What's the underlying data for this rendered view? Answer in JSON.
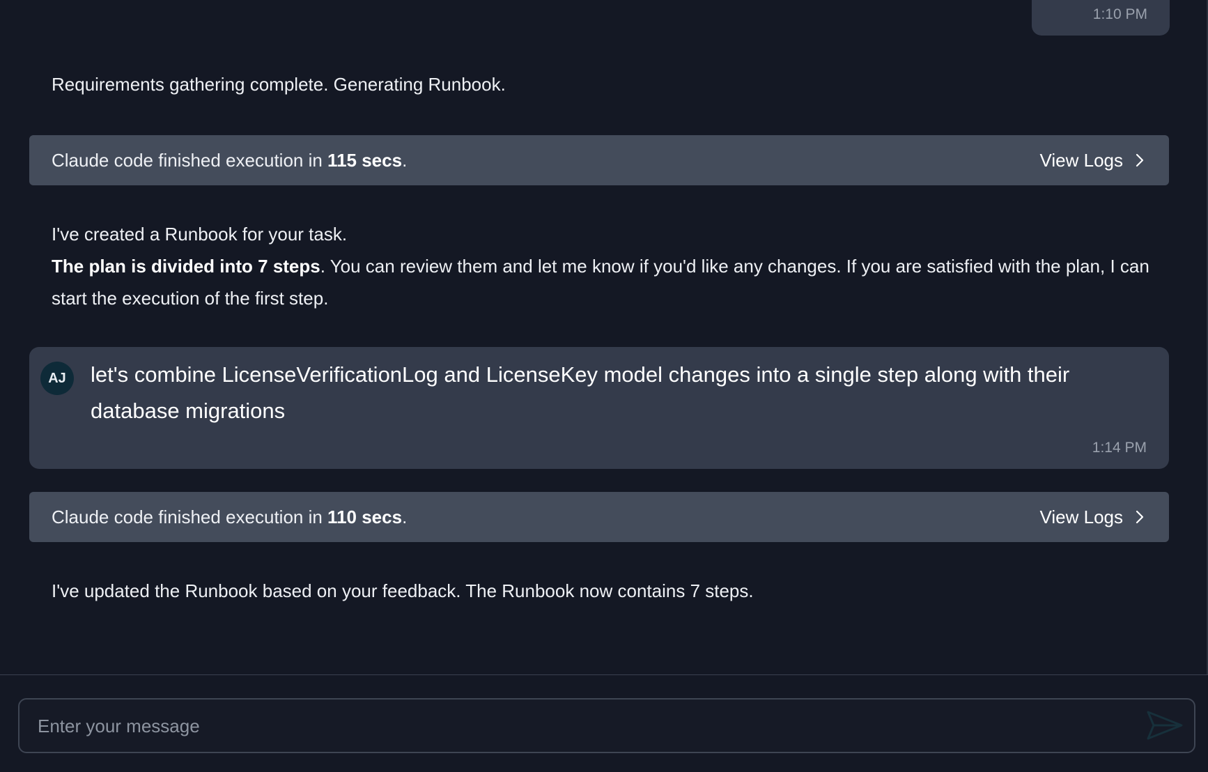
{
  "chat": {
    "prev_user_message": {
      "time": "1:10 PM"
    },
    "assistant_req": "Requirements gathering complete. Generating Runbook.",
    "exec_1": {
      "prefix": "Claude code finished execution in ",
      "duration": "115 secs",
      "suffix": ".",
      "view_logs_label": "View Logs"
    },
    "runbook_message": {
      "line1": "I've created a Runbook for your task.",
      "bold": "The plan is divided into 7 steps",
      "rest": ". You can review them and let me know if you'd like any changes. If you are satisfied with the plan, I can start the execution of the first step."
    },
    "user_message": {
      "avatar_initials": "AJ",
      "text": "let's combine LicenseVerificationLog and LicenseKey model changes into a single step along with their database migrations",
      "time": "1:14 PM"
    },
    "exec_2": {
      "prefix": "Claude code finished execution in ",
      "duration": "110 secs",
      "suffix": ".",
      "view_logs_label": "View Logs"
    },
    "assistant_updated": "I've updated the Runbook based on your feedback. The Runbook now contains 7 steps."
  },
  "composer": {
    "placeholder": "Enter your message",
    "value": "",
    "send_icon": "send-icon"
  },
  "colors": {
    "background": "#141824",
    "exec_bar": "#444c5b",
    "user_bubble": "#343b4b",
    "avatar": "#0e2a38",
    "send_icon": "#17303b"
  }
}
